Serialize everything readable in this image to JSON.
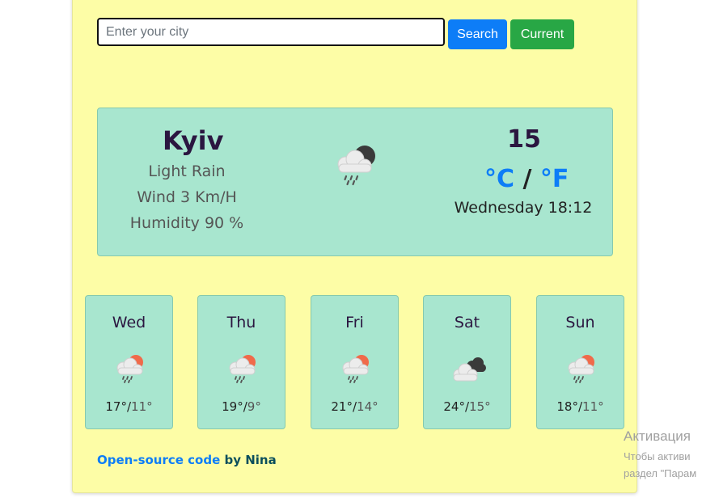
{
  "search": {
    "placeholder": "Enter your city",
    "value": ""
  },
  "buttons": {
    "search_label": "Search",
    "current_label": "Current"
  },
  "current": {
    "city": "Kyiv",
    "description": "Light Rain",
    "wind": "Wind 3 Km/H",
    "humidity": "Humidity 90 %",
    "temperature": "15",
    "unit_c": "°C",
    "unit_sep": " / ",
    "unit_f": "°F",
    "datetime": "Wednesday 18:12",
    "icon": "night-rain-cloud-icon"
  },
  "forecast": [
    {
      "day": "Wed",
      "max": "17°",
      "min": "11°",
      "icon": "day-rain-cloud-icon"
    },
    {
      "day": "Thu",
      "max": "19°",
      "min": "9°",
      "icon": "day-rain-cloud-icon"
    },
    {
      "day": "Fri",
      "max": "21°",
      "min": "14°",
      "icon": "day-rain-cloud-icon"
    },
    {
      "day": "Sat",
      "max": "24°",
      "min": "15°",
      "icon": "broken-clouds-icon"
    },
    {
      "day": "Sun",
      "max": "18°",
      "min": "11°",
      "icon": "day-rain-cloud-icon"
    }
  ],
  "footer": {
    "link_text": "Open-source code",
    "suffix": " by Nina"
  },
  "overlay": {
    "title": "Активация",
    "line1": "Чтобы активи",
    "line2": "раздел \"Парам"
  },
  "colors": {
    "background": "#fdfda6",
    "card": "#a8e6cf",
    "primary": "#0d7df7",
    "success": "#28a745",
    "heading": "#2b1640"
  }
}
